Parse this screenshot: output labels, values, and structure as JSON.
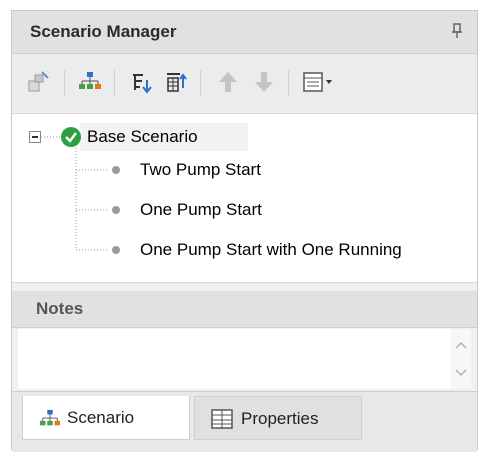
{
  "panel": {
    "title": "Scenario Manager",
    "pin_glyph": "▮"
  },
  "toolbar": {
    "buttons": [
      {
        "name": "create-child-scenario-button",
        "icon": "new-scenario-icon"
      },
      {
        "name": "scenario-tree-button",
        "icon": "hierarchy-icon"
      },
      {
        "name": "sort-down-button",
        "icon": "sort-down-icon"
      },
      {
        "name": "sort-filter-button",
        "icon": "filter-table-icon"
      },
      {
        "name": "move-up-button",
        "icon": "arrow-up-icon"
      },
      {
        "name": "move-down-button",
        "icon": "arrow-down-icon"
      },
      {
        "name": "view-options-button",
        "icon": "list-dropdown-icon"
      }
    ]
  },
  "tree": {
    "root": {
      "label": "Base Scenario",
      "expanded": true,
      "status": "ok"
    },
    "children": [
      {
        "label": "Two Pump Start"
      },
      {
        "label": "One Pump Start"
      },
      {
        "label": "One Pump Start with One Running"
      }
    ],
    "status_color": "#2ea043"
  },
  "notes": {
    "label": "Notes",
    "text": ""
  },
  "tabs": [
    {
      "label": "Scenario",
      "icon": "hierarchy-icon",
      "active": true
    },
    {
      "label": "Properties",
      "icon": "grid-icon",
      "active": false
    }
  ]
}
